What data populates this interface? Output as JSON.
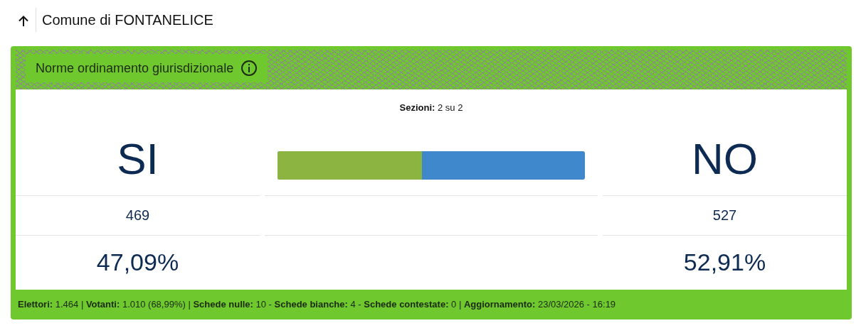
{
  "page_title": "Comune di FONTANELICE",
  "card": {
    "title": "Norme ordinamento giurisdizionale",
    "sections": "**Sezioni:** 2 su 2",
    "options": [
      {
        "label": "SI",
        "votes": "469",
        "percent": "47,09%"
      },
      {
        "label": "NO",
        "votes": "527",
        "percent": "52,91%"
      }
    ],
    "bar": {
      "level": 0.4709
    },
    "footer": "**Elettori:** 1.464 | **Votanti:** 1.010 (68,99%) | **Schede nulle:** 10 - **Schede bianche:** 4 - **Schede contestate:** 0 | **Aggiornamento:** 23/03/2026 - 16:19"
  }
}
